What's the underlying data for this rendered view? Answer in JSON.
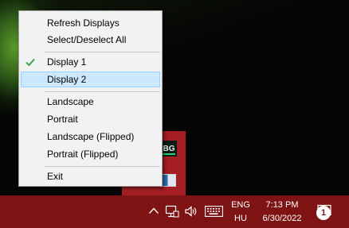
{
  "menu": {
    "items": [
      {
        "label": "Refresh Displays",
        "checked": false,
        "highlighted": false
      },
      {
        "label": "Select/Deselect All",
        "checked": false,
        "highlighted": false
      },
      {
        "label": "Display 1",
        "checked": true,
        "highlighted": false
      },
      {
        "label": "Display 2",
        "checked": false,
        "highlighted": true
      },
      {
        "label": "Landscape",
        "checked": false,
        "highlighted": false
      },
      {
        "label": "Portrait",
        "checked": false,
        "highlighted": false
      },
      {
        "label": "Landscape (Flipped)",
        "checked": false,
        "highlighted": false
      },
      {
        "label": "Portrait (Flipped)",
        "checked": false,
        "highlighted": false
      },
      {
        "label": "Exit",
        "checked": false,
        "highlighted": false
      }
    ]
  },
  "tray_flyout": {
    "app_icon_text": "BG"
  },
  "taskbar": {
    "show_hidden_icon": "chevron-up-icon",
    "language_top": "ENG",
    "language_bottom": "HU",
    "time": "7:13 PM",
    "date": "6/30/2022",
    "notification_count": "1"
  },
  "colors": {
    "taskbar": "#7e1313",
    "flyout": "#a41e24",
    "menu_bg": "#f2f2f2",
    "highlight": "#cce8ff",
    "check": "#2f9e44"
  }
}
